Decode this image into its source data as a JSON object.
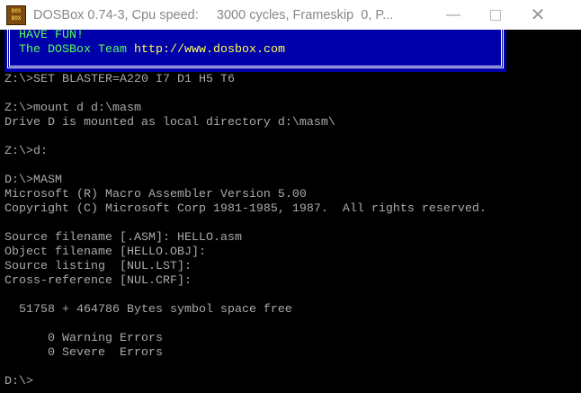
{
  "window": {
    "title": "DOSBox 0.74-3, Cpu speed:     3000 cycles, Frameskip  0, P...",
    "icon_text": [
      "DOS",
      "BOX"
    ],
    "minimize_icon": "minimize-icon",
    "maximize_icon": "maximize-icon",
    "close_icon": "close-icon"
  },
  "banner": {
    "line1": "HAVE FUN!",
    "line2_prefix": "The DOSBox Team ",
    "line2_url": "http://www.dosbox.com"
  },
  "terminal": {
    "lines": [
      "Z:\\>SET BLASTER=A220 I7 D1 H5 T6",
      "",
      "Z:\\>mount d d:\\masm",
      "Drive D is mounted as local directory d:\\masm\\",
      "",
      "Z:\\>d:",
      "",
      "D:\\>MASM",
      "Microsoft (R) Macro Assembler Version 5.00",
      "Copyright (C) Microsoft Corp 1981-1985, 1987.  All rights reserved.",
      "",
      "Source filename [.ASM]: HELLO.asm",
      "Object filename [HELLO.OBJ]:",
      "Source listing  [NUL.LST]:",
      "Cross-reference [NUL.CRF]:",
      "",
      "  51758 + 464786 Bytes symbol space free",
      "",
      "      0 Warning Errors",
      "      0 Severe  Errors",
      "",
      "D:\\>"
    ]
  },
  "colors": {
    "banner_bg": "#0000aa",
    "text": "#aaaaaa",
    "green": "#55ff55",
    "yellow": "#ffff55"
  }
}
